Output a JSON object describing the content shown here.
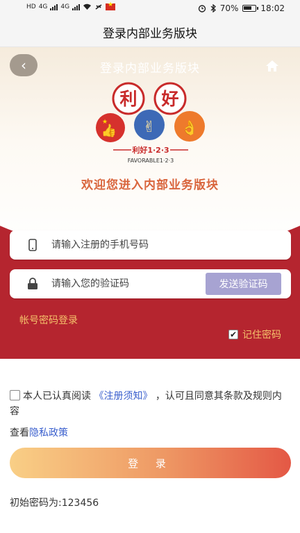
{
  "status_bar": {
    "left_labels": [
      "HD",
      "4G",
      "4G"
    ],
    "battery": "70%",
    "time": "18:02"
  },
  "app_header": {
    "title": "登录内部业务版块"
  },
  "hero": {
    "title": "登录内部业务版块",
    "logo": {
      "chars": [
        "利",
        "好"
      ],
      "tagline": "利好1·2·3",
      "subtag": "FAVORABLE1·2·3"
    },
    "welcome": "欢迎您进入内部业务版块"
  },
  "form": {
    "phone_placeholder": "请输入注册的手机号码",
    "code_placeholder": "请输入您的验证码",
    "send_code_label": "发送验证码",
    "password_login_label": "帐号密码登录",
    "remember_label": "记住密码",
    "remember_checked": true
  },
  "agreement": {
    "prefix": "本人已认真阅读",
    "link_text": "《注册须知》",
    "suffix": "，认可且同意其条款及规则内容",
    "privacy_prefix": "查看",
    "privacy_link": "隐私政策"
  },
  "login_label": "登 录",
  "initial_password": "初始密码为:123456",
  "colors": {
    "brand_red": "#b5252f",
    "accent_gold": "#f5c26b",
    "send_button": "#a7a3d2",
    "link_blue": "#3a5fcd"
  }
}
